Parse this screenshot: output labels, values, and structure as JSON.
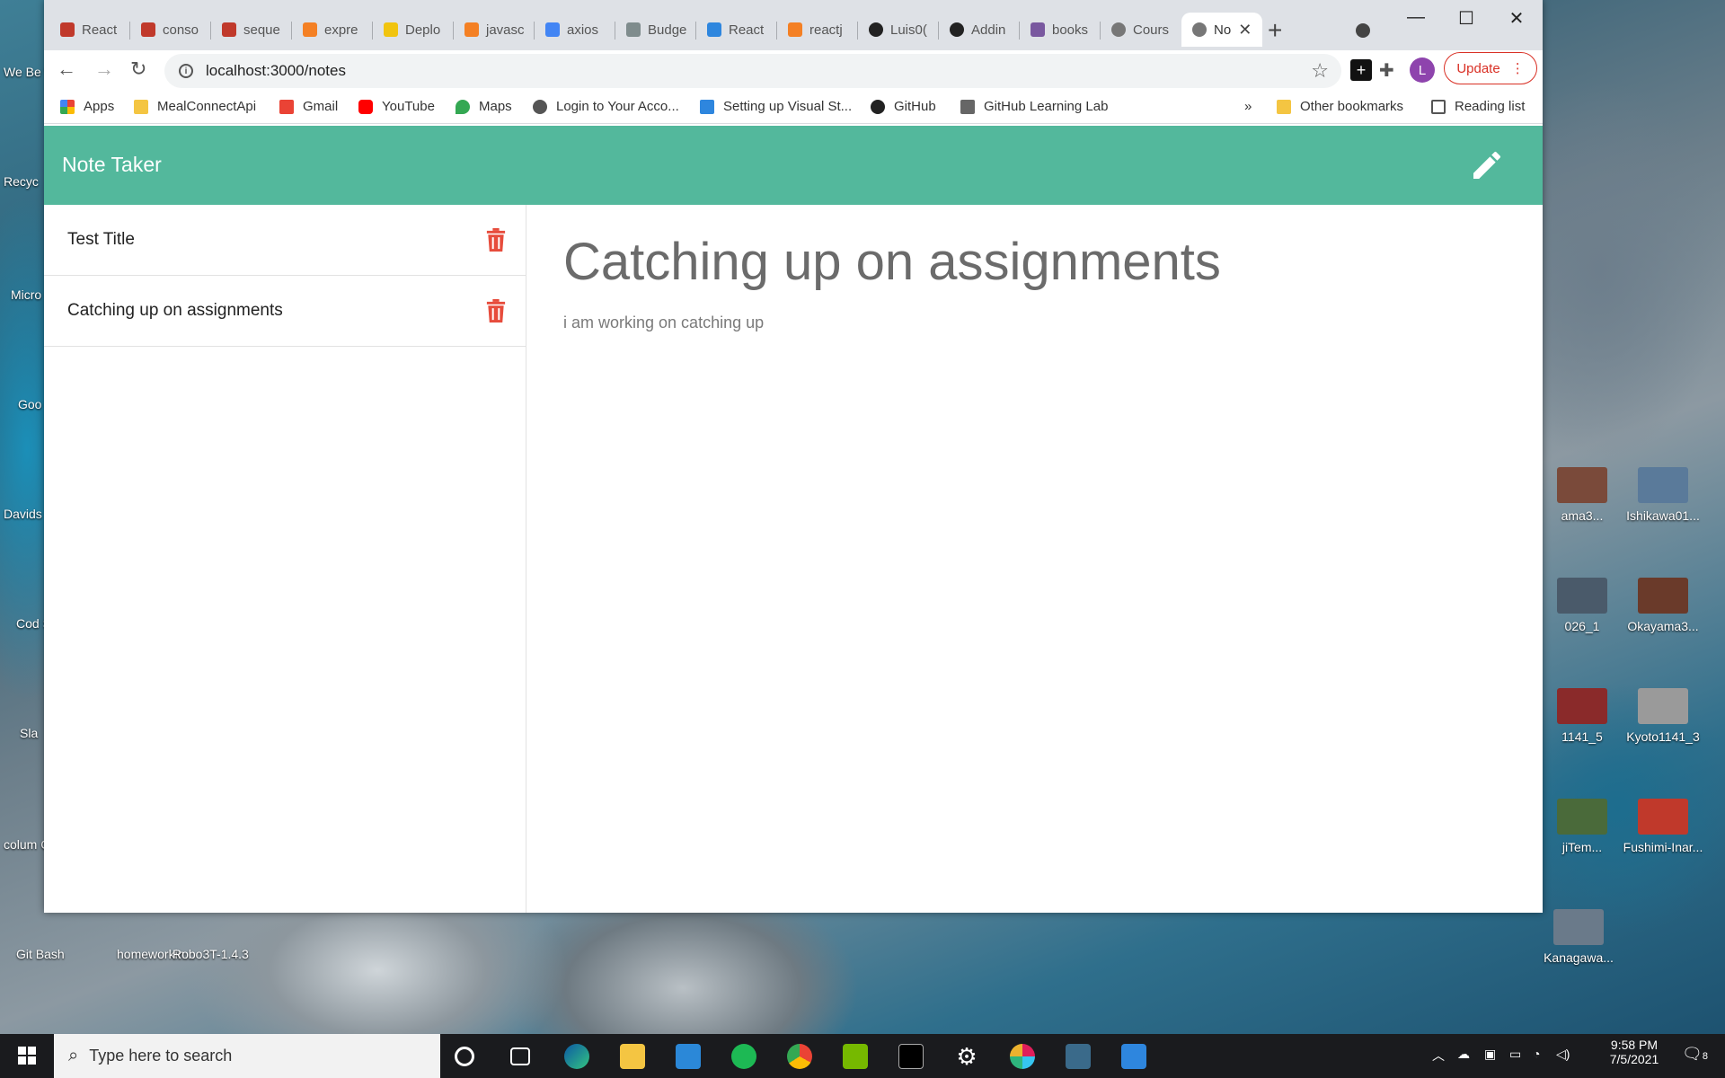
{
  "desktop": {
    "left_icons": [
      "We Be What",
      "Recyc",
      "Micro Ed",
      "Goo Chro",
      "Davids",
      "Cod Sho",
      "Sla",
      "colum CU-N",
      "Git Bash",
      "homeworkin...",
      "Robo3T-1.4.3"
    ],
    "right_icons": [
      "ama3...",
      "Ishikawa01...",
      "026_1",
      "Okayama3...",
      "1141_5",
      "Kyoto1141_3",
      "jiTem...",
      "Fushimi-Inar...",
      "Kanagawa..."
    ]
  },
  "browser": {
    "tabs": [
      {
        "label": "React",
        "icon": "react-favicon",
        "color": "#c0392b"
      },
      {
        "label": "conso",
        "icon": "redbox-favicon",
        "color": "#c0392b"
      },
      {
        "label": "seque",
        "icon": "redbox-favicon",
        "color": "#c0392b"
      },
      {
        "label": "expre",
        "icon": "stackoverflow-favicon",
        "color": "#f48024"
      },
      {
        "label": "Deplo",
        "icon": "fs-favicon",
        "color": "#f1c40f"
      },
      {
        "label": "javasc",
        "icon": "stackoverflow-favicon",
        "color": "#f48024"
      },
      {
        "label": "axios",
        "icon": "google-favicon",
        "color": "#4285f4"
      },
      {
        "label": "Budge",
        "icon": "budget-favicon",
        "color": "#7f8c8d"
      },
      {
        "label": "React",
        "icon": "vscode-favicon",
        "color": "#2e86de"
      },
      {
        "label": "reactj",
        "icon": "stackoverflow-favicon",
        "color": "#f48024"
      },
      {
        "label": "Luis0(",
        "icon": "github-favicon",
        "color": "#222"
      },
      {
        "label": "Addin",
        "icon": "github-favicon",
        "color": "#222"
      },
      {
        "label": "books",
        "icon": "heroku-favicon",
        "color": "#79589f"
      },
      {
        "label": "Cours",
        "icon": "globe-favicon",
        "color": "#666"
      },
      {
        "label": "No",
        "icon": "globe-favicon",
        "color": "#666",
        "active": true
      }
    ],
    "url": "localhost:3000/notes",
    "update_label": "Update",
    "avatar_letter": "L",
    "bookmarks": [
      {
        "label": "Apps",
        "icon": "apps-grid-icon"
      },
      {
        "label": "MealConnectApi",
        "icon": "folder-icon"
      },
      {
        "label": "Gmail",
        "icon": "gmail-icon"
      },
      {
        "label": "YouTube",
        "icon": "youtube-icon"
      },
      {
        "label": "Maps",
        "icon": "maps-icon"
      },
      {
        "label": "Login to Your Acco...",
        "icon": "globe-icon"
      },
      {
        "label": "Setting up Visual St...",
        "icon": "vscode-icon"
      },
      {
        "label": "GitHub",
        "icon": "github-icon"
      },
      {
        "label": "GitHub Learning Lab",
        "icon": "learning-lab-icon"
      }
    ],
    "bookmarks_overflow": "»",
    "other_bookmarks": "Other bookmarks",
    "reading_list": "Reading list"
  },
  "app": {
    "title": "Note Taker",
    "notes": [
      {
        "title": "Test Title"
      },
      {
        "title": "Catching up on assignments"
      }
    ],
    "active_note": {
      "title": "Catching up on assignments",
      "text": "i am working on catching up"
    },
    "accent_color": "#53b89c",
    "delete_color": "#e74c3c"
  },
  "taskbar": {
    "search_placeholder": "Type here to search",
    "time": "9:58 PM",
    "date": "7/5/2021",
    "notification_count": "8"
  }
}
